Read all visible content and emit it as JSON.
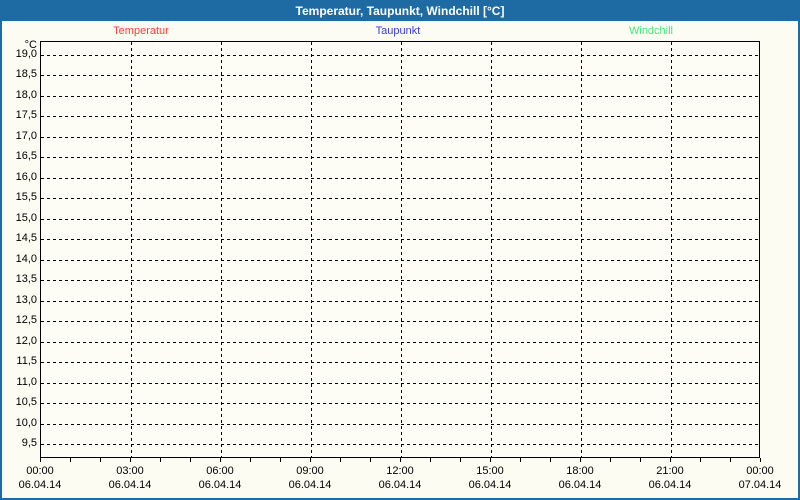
{
  "window": {
    "title": "Temperatur, Taupunkt, Windchill [°C]"
  },
  "colors": {
    "titlebar": "#1e6ba4",
    "border": "#1e6ba4",
    "background": "#fcfcf2",
    "plot_background": "#fdfdf6",
    "grid": "#000000",
    "temperatur": "#ff4040",
    "taupunkt": "#3a3ae0",
    "windchill": "#47e57c"
  },
  "legend": {
    "items": [
      {
        "label": "Temperatur",
        "color_key": "temperatur"
      },
      {
        "label": "Taupunkt",
        "color_key": "taupunkt"
      },
      {
        "label": "Windchill",
        "color_key": "windchill"
      }
    ]
  },
  "chart_data": {
    "type": "line",
    "title": "Temperatur, Taupunkt, Windchill [°C]",
    "ylabel": "°C",
    "ylim": [
      9.5,
      19.0
    ],
    "y_tick_step": 0.5,
    "y_tick_labels": [
      "19,0",
      "18,5",
      "18,0",
      "17,5",
      "17,0",
      "16,5",
      "16,0",
      "15,5",
      "15,0",
      "14,5",
      "14,0",
      "13,5",
      "13,0",
      "12,5",
      "12,0",
      "11,5",
      "11,0",
      "10,5",
      "10,0",
      "9,5"
    ],
    "grid": "dashed-both-axes",
    "legend_position": "top",
    "x_axis": {
      "hours_span": 24,
      "minor_tick_hours": 1,
      "major_tick_hours": 3,
      "tick_labels": [
        {
          "time": "00:00",
          "date": "06.04.14"
        },
        {
          "time": "03:00",
          "date": "06.04.14"
        },
        {
          "time": "06:00",
          "date": "06.04.14"
        },
        {
          "time": "09:00",
          "date": "06.04.14"
        },
        {
          "time": "12:00",
          "date": "06.04.14"
        },
        {
          "time": "15:00",
          "date": "06.04.14"
        },
        {
          "time": "18:00",
          "date": "06.04.14"
        },
        {
          "time": "21:00",
          "date": "06.04.14"
        },
        {
          "time": "00:00",
          "date": "07.04.14"
        }
      ]
    },
    "series": [
      {
        "name": "Temperatur",
        "color": "#ff4040",
        "values": []
      },
      {
        "name": "Taupunkt",
        "color": "#3a3ae0",
        "values": []
      },
      {
        "name": "Windchill",
        "color": "#47e57c",
        "values": []
      }
    ]
  }
}
